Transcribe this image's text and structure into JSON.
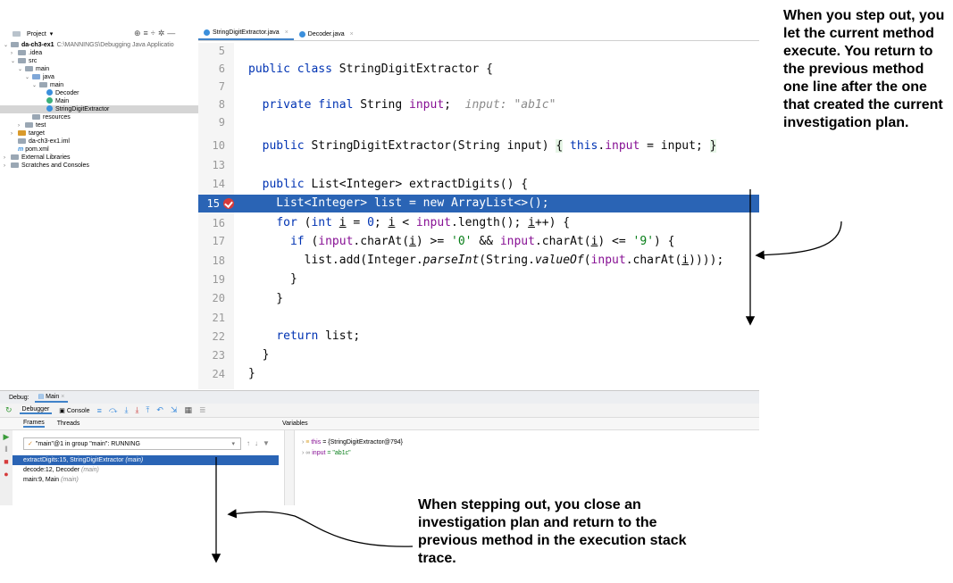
{
  "project_panel": {
    "title": "Project",
    "tree": [
      {
        "label": "da-ch3-ex1",
        "path": "C:\\MANNINGS\\Debugging Java Applicatio",
        "kind": "module",
        "depth": 0
      },
      {
        "label": ".idea",
        "kind": "folder",
        "depth": 1
      },
      {
        "label": "src",
        "kind": "folder",
        "depth": 1
      },
      {
        "label": "main",
        "kind": "folder",
        "depth": 2
      },
      {
        "label": "java",
        "kind": "folder-blue",
        "depth": 3
      },
      {
        "label": "main",
        "kind": "package",
        "depth": 4
      },
      {
        "label": "Decoder",
        "kind": "class",
        "depth": 5
      },
      {
        "label": "Main",
        "kind": "class-main",
        "depth": 5
      },
      {
        "label": "StringDigitExtractor",
        "kind": "class",
        "depth": 5,
        "selected": true
      },
      {
        "label": "resources",
        "kind": "folder",
        "depth": 3
      },
      {
        "label": "test",
        "kind": "folder",
        "depth": 2
      },
      {
        "label": "target",
        "kind": "folder-orange",
        "depth": 1
      },
      {
        "label": "da-ch3-ex1.iml",
        "kind": "file",
        "depth": 1
      },
      {
        "label": "pom.xml",
        "kind": "xml",
        "depth": 1
      },
      {
        "label": "External Libraries",
        "kind": "lib",
        "depth": 0
      },
      {
        "label": "Scratches and Consoles",
        "kind": "scratch",
        "depth": 0
      }
    ]
  },
  "editor": {
    "tabs": [
      {
        "label": "StringDigitExtractor.java",
        "active": true
      },
      {
        "label": "Decoder.java",
        "active": false
      }
    ],
    "line_numbers": [
      "5",
      "6",
      "7",
      "8",
      "9",
      "10",
      "13",
      "14",
      "15",
      "16",
      "17",
      "18",
      "19",
      "20",
      "21",
      "22",
      "23",
      "24"
    ],
    "current_line": "15"
  },
  "debug": {
    "label": "Debug:",
    "run_config": "Main",
    "tabs": [
      "Debugger",
      "Console"
    ],
    "subtabs": [
      "Frames",
      "Threads"
    ],
    "variables_title": "Variables",
    "thread": "\"main\"@1 in group \"main\": RUNNING",
    "frames": [
      {
        "text": "extractDigits:15, StringDigitExtractor",
        "module": "(main)",
        "selected": true
      },
      {
        "text": "decode:12, Decoder",
        "module": "(main)",
        "selected": false
      },
      {
        "text": "main:9, Main",
        "module": "(main)",
        "selected": false
      }
    ],
    "variables": [
      {
        "name": "this",
        "value": "= {StringDigitExtractor@794}"
      },
      {
        "name": "input",
        "value": "= \"ab1c\""
      }
    ]
  },
  "annotations": {
    "top": "When you step out, you let the current method execute. You return to the previous method one line after the one that created the current investigation plan.",
    "bottom": "When stepping out, you close an investigation plan and return to the previous method in the execution stack trace."
  }
}
